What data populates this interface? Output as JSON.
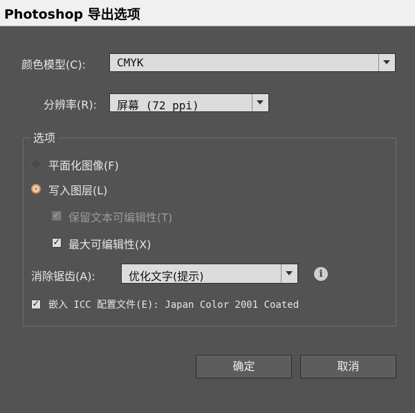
{
  "window": {
    "title": "Photoshop 导出选项"
  },
  "color_model": {
    "label": "颜色模型(C):",
    "value": "CMYK"
  },
  "resolution": {
    "label": "分辨率(R):",
    "value": "屏幕 (72 ppi)"
  },
  "options": {
    "title": "选项",
    "flat_image": {
      "label": "平面化图像(F)",
      "selected": false
    },
    "write_layers": {
      "label": "写入图层(L)",
      "selected": true
    },
    "preserve_text": {
      "label": "保留文本可编辑性(T)",
      "checked": true,
      "enabled": false
    },
    "max_editability": {
      "label": "最大可编辑性(X)",
      "checked": true
    },
    "antialias": {
      "label": "消除锯齿(A):",
      "value": "优化文字(提示)"
    },
    "embed_icc": {
      "label": "嵌入 ICC 配置文件(E): Japan Color 2001 Coated",
      "checked": true
    }
  },
  "buttons": {
    "ok": "确定",
    "cancel": "取消"
  },
  "colors": {
    "dialog_bg": "#535353",
    "radio_accent": "#e8893a"
  },
  "icons": {
    "info": "info-icon",
    "dropdown": "chevron-down-icon",
    "check": "checkmark-icon"
  }
}
